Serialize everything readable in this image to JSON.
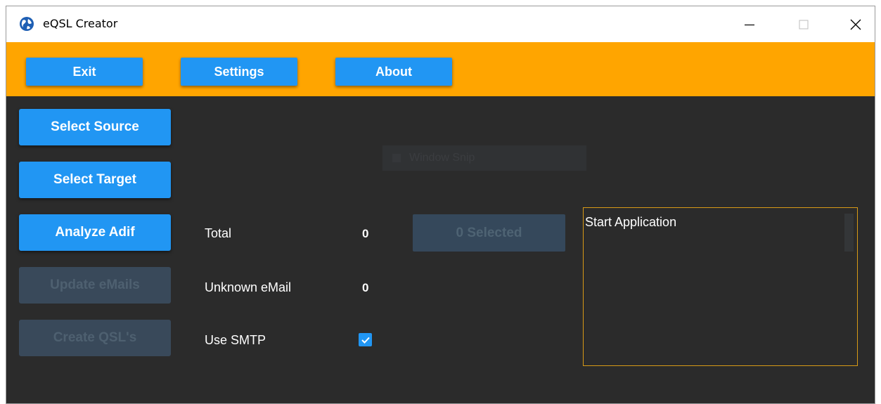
{
  "window": {
    "title": "eQSL Creator"
  },
  "toolbar": {
    "exit_label": "Exit",
    "settings_label": "Settings",
    "about_label": "About"
  },
  "actions": {
    "select_source": "Select Source",
    "select_target": "Select Target",
    "analyze_adif": "Analyze Adif",
    "update_emails": "Update eMails",
    "create_qsls": "Create QSL's"
  },
  "stats": {
    "total_label": "Total",
    "total_value": "0",
    "unknown_label": "Unknown eMail",
    "unknown_value": "0",
    "smtp_label": "Use SMTP",
    "smtp_checked": true
  },
  "selected_button": "0 Selected",
  "ghost_text": "Window Snip",
  "log": {
    "text": "Start Application"
  },
  "colors": {
    "accent": "#2196f3",
    "toolbar": "#ffa500",
    "background": "#2b2b2b",
    "log_border": "#d89a16"
  }
}
